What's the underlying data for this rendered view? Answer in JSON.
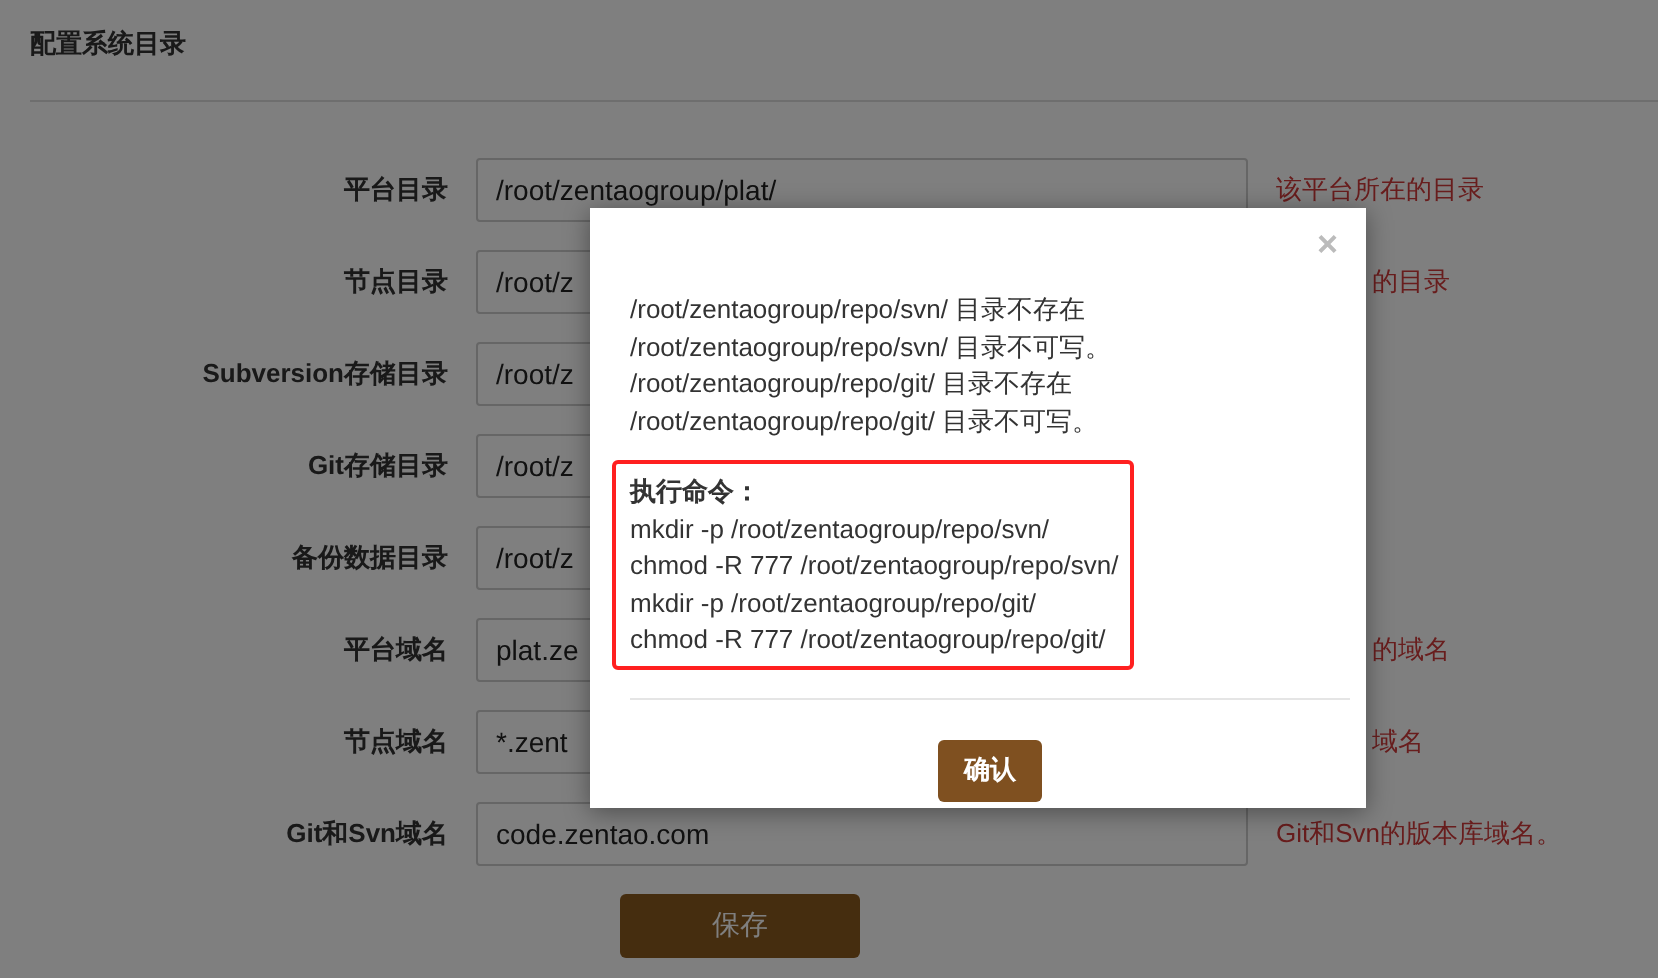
{
  "page": {
    "title": "配置系统目录"
  },
  "form": {
    "rows": [
      {
        "label": "平台目录",
        "value": "/root/zentaogroup/plat/",
        "hint": "该平台所在的目录",
        "hint_covered": false
      },
      {
        "label": "节点目录",
        "value": "/root/z",
        "hint": "的目录",
        "hint_covered": true
      },
      {
        "label": "Subversion存储目录",
        "value": "/root/z"
      },
      {
        "label": "Git存储目录",
        "value": "/root/z"
      },
      {
        "label": "备份数据目录",
        "value": "/root/z"
      },
      {
        "label": "平台域名",
        "value": "plat.ze",
        "hint": "的域名",
        "hint_covered": true
      },
      {
        "label": "节点域名",
        "value": "*.zent",
        "hint": "域名",
        "hint_covered": true
      },
      {
        "label": "Git和Svn域名",
        "value": "code.zentao.com",
        "hint": "Git和Svn的版本库域名。",
        "hint_covered": false
      }
    ],
    "save_button": "保存"
  },
  "modal": {
    "close": "×",
    "messages": [
      "/root/zentaogroup/repo/svn/ 目录不存在",
      "/root/zentaogroup/repo/svn/ 目录不可写。",
      "/root/zentaogroup/repo/git/ 目录不存在",
      "/root/zentaogroup/repo/git/ 目录不可写。"
    ],
    "commands": {
      "title": "执行命令：",
      "lines": [
        "mkdir -p /root/zentaogroup/repo/svn/",
        "chmod -R 777 /root/zentaogroup/repo/svn/",
        "mkdir -p /root/zentaogroup/repo/git/",
        "chmod -R 777 /root/zentaogroup/repo/git/"
      ]
    },
    "confirm_button": "确认"
  }
}
